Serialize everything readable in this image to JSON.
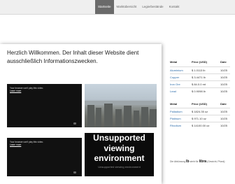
{
  "nav": {
    "items": [
      {
        "label": "Startseite",
        "active": true
      },
      {
        "label": "Marktübersicht",
        "active": false
      },
      {
        "label": "Legierbestände",
        "active": false
      },
      {
        "label": "Kontakt",
        "active": false
      }
    ]
  },
  "main": {
    "welcome_text": "Herzlich Willkommen. Der Inhalt dieser Website dient ausschließlich Informationszwecken."
  },
  "videos": [
    {
      "message": "Your browser can't play this video.",
      "link": "Learn more"
    },
    {
      "message": "Your browser can't play this video.",
      "link": "Learn more"
    }
  ],
  "unsupported": {
    "title": "Unsupported viewing environment",
    "subtitle": "Unsupported viewing environment"
  },
  "prices": {
    "table1": {
      "headers": [
        "Metal",
        "Price (USD)",
        "Date"
      ],
      "rows": [
        [
          "Aluminium",
          "$ 1.0113 lb",
          "10/25"
        ],
        [
          "Copper",
          "$ 3.4471 lb",
          "10/25"
        ],
        [
          "Iron Ore",
          "$ 84.0.0 mt",
          "10/25"
        ],
        [
          "Lead",
          "$ 0.9098 lb",
          "10/25"
        ]
      ]
    },
    "table2": {
      "headers": [
        "Metal",
        "Price (USD)",
        "Date"
      ],
      "rows": [
        [
          "Palladium",
          "$ 1824.35 oz",
          "10/25"
        ],
        [
          "Platinum",
          "$ 971.10 oz",
          "10/25"
        ],
        [
          "Rhodium",
          "$ 14100.00 oz",
          "10/25"
        ]
      ]
    }
  },
  "footnote": {
    "prefix": "Die Abkürzung",
    "abbr_lb": "lb",
    "middle": "steht für",
    "word": "libra",
    "suffix": "(Gewicht, Pfund)."
  }
}
